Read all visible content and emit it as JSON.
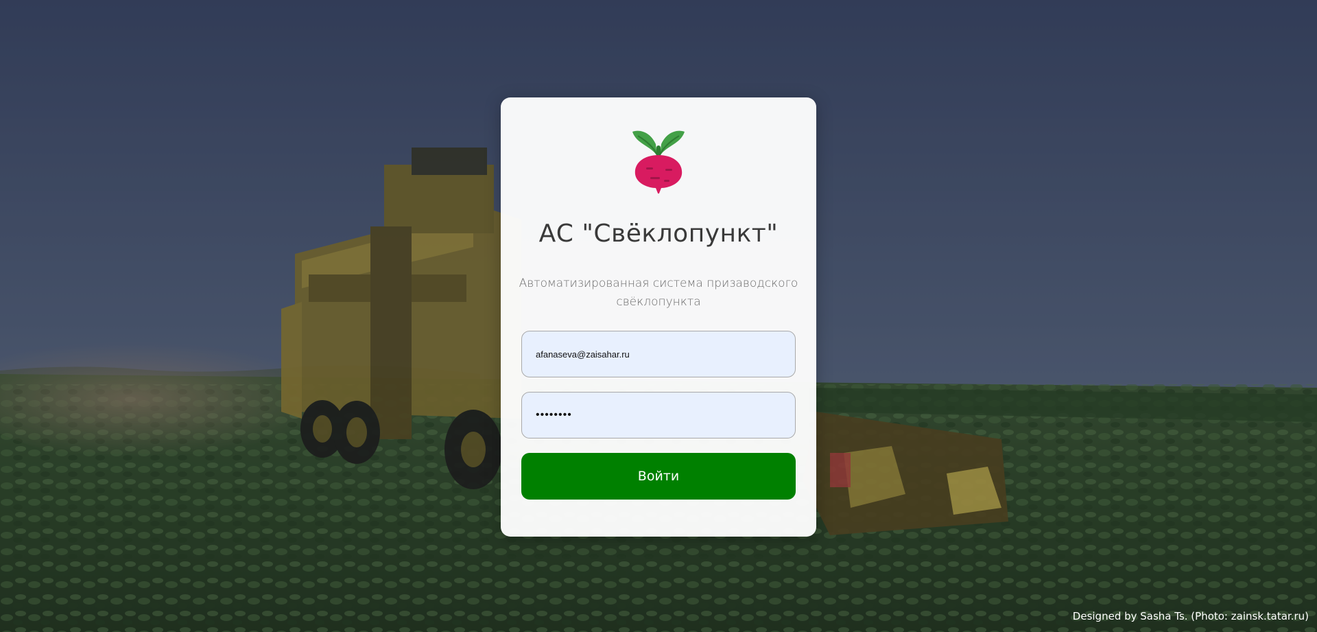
{
  "app": {
    "title": "АС \"Свёклопункт\"",
    "subtitle": "Автоматизированная система призаводского свёклопункта"
  },
  "login": {
    "email_value": "afanaseva@zaisahar.ru",
    "password_value": "••••••••",
    "submit_label": "Войти"
  },
  "footer": {
    "credit": "Designed by Sasha Ts. (Photo: zainsk.tatar.ru)"
  },
  "icons": {
    "logo": "beet-icon"
  },
  "colors": {
    "button": "#008000",
    "input_bg": "#e8f0fe",
    "beet": "#d81b60",
    "leaves": "#43a047"
  }
}
